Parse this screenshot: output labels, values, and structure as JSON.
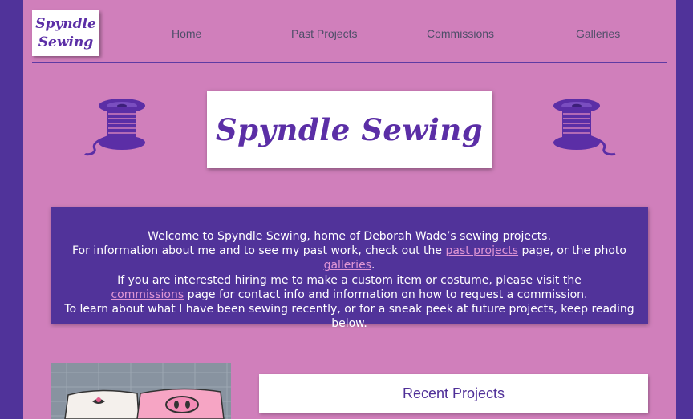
{
  "brand": {
    "logo_text_line1": "Spyndle",
    "logo_text_line2": "Sewing"
  },
  "nav": {
    "items": [
      {
        "label": "Home"
      },
      {
        "label": "Past Projects"
      },
      {
        "label": "Commissions"
      },
      {
        "label": "Galleries"
      }
    ]
  },
  "hero": {
    "title": "Spyndle Sewing",
    "left_icon": "spool-of-thread-icon",
    "right_icon": "spool-of-thread-icon"
  },
  "welcome": {
    "line1": "Welcome to Spyndle Sewing, home of Deborah Wade’s sewing projects.",
    "line2_pre": "For information about me and to see my past work, check out the ",
    "line2_link1": "past projects",
    "line2_mid": " page, or the photo ",
    "line2_link2": "galleries",
    "line2_post": ".",
    "line3_pre": "If you are interested hiring me to make a custom item or costume, please visit the ",
    "line3_link": "commissions",
    "line3_post": " page for contact info and information on how to request a commission.",
    "line4": "To learn about what I have been sewing recently, or for a sneak peek at future projects, keep reading below."
  },
  "recent": {
    "heading": "Recent Projects"
  },
  "colors": {
    "page_bg": "#d07fbb",
    "outer_bg": "#50339a",
    "accent": "#5b2ea6",
    "link": "#e096d4"
  }
}
